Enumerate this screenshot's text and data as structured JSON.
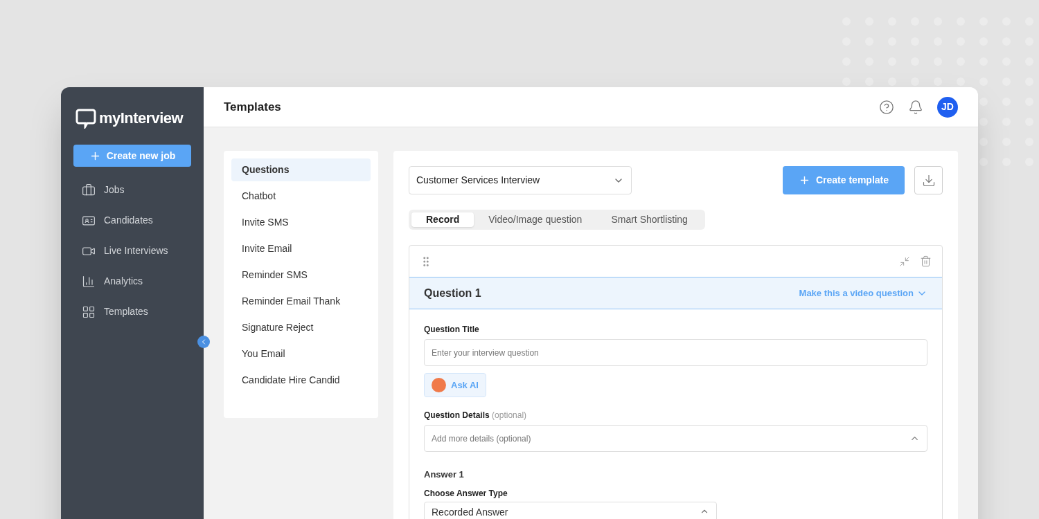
{
  "brand": {
    "logo_text": "myInterview"
  },
  "sidebar": {
    "create_button": "Create new job",
    "items": [
      {
        "label": "Jobs"
      },
      {
        "label": "Candidates"
      },
      {
        "label": "Live Interviews"
      },
      {
        "label": "Analytics"
      },
      {
        "label": "Templates"
      }
    ]
  },
  "header": {
    "title": "Templates",
    "avatar_initials": "JD"
  },
  "template_types": [
    {
      "label": "Questions",
      "selected": true
    },
    {
      "label": "Chatbot",
      "selected": false
    },
    {
      "label": "Invite SMS",
      "selected": false
    },
    {
      "label": "Invite Email",
      "selected": false
    },
    {
      "label": "Reminder SMS",
      "selected": false
    },
    {
      "label": "Reminder Email Thank",
      "selected": false
    },
    {
      "label": "Signature Reject",
      "selected": false
    },
    {
      "label": "You Email",
      "selected": false
    },
    {
      "label": "Candidate Hire Candid",
      "selected": false
    }
  ],
  "template_select": {
    "value": "Customer Services Interview"
  },
  "create_template_button": "Create template",
  "tabs": [
    {
      "label": "Record",
      "selected": true
    },
    {
      "label": "Video/Image question",
      "selected": false
    },
    {
      "label": "Smart Shortlisting",
      "selected": false
    }
  ],
  "question": {
    "title": "Question 1",
    "video_link": "Make this a video question",
    "title_label": "Question Title",
    "title_placeholder": "Enter your interview question",
    "ask_ai": "Ask AI",
    "details_label": "Question Details",
    "details_optional": "(optional)",
    "details_placeholder": "Add more details (optional)",
    "answer_heading": "Answer 1",
    "answer_type_label": "Choose Answer Type",
    "answer_type_value": "Recorded Answer"
  }
}
